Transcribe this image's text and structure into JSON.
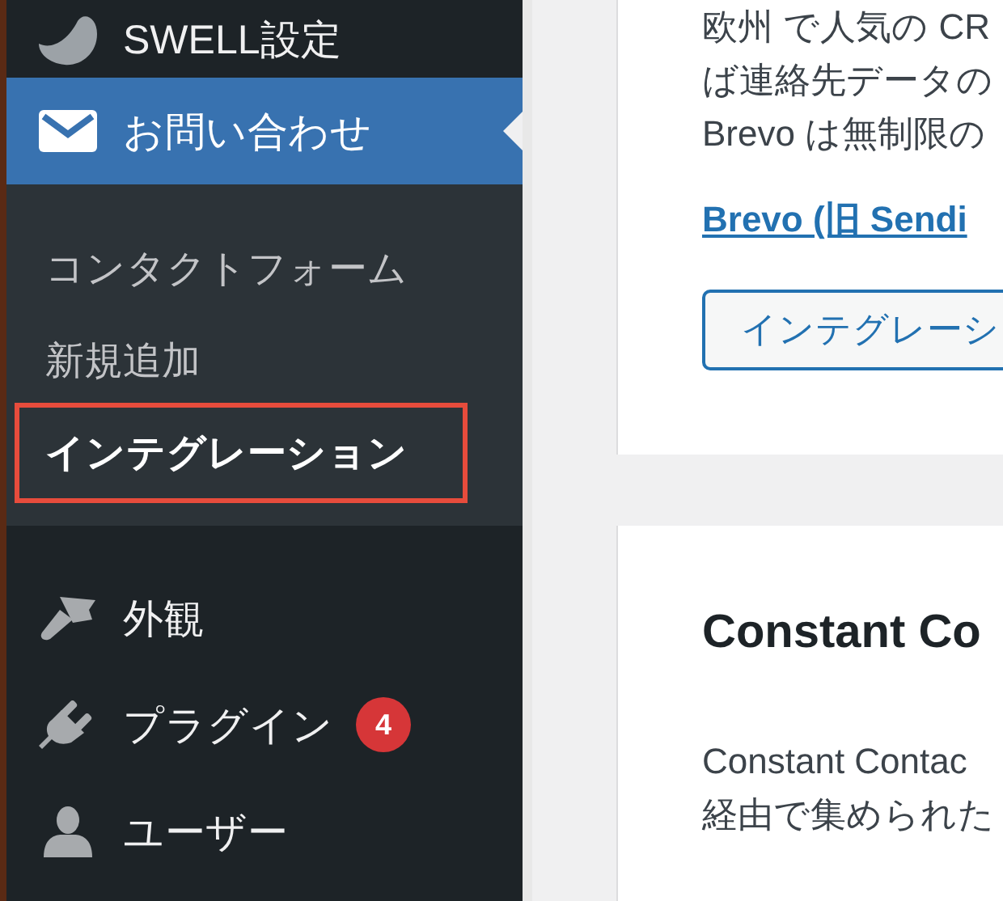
{
  "sidebar": {
    "items": [
      {
        "label": "SWELL設定",
        "selected": false
      },
      {
        "label": "お問い合わせ",
        "selected": true,
        "submenu": [
          {
            "label": "コンタクトフォーム",
            "selected": false,
            "highlighted": false
          },
          {
            "label": "新規追加",
            "selected": false,
            "highlighted": false
          },
          {
            "label": "インテグレーション",
            "selected": true,
            "highlighted": true
          }
        ]
      },
      {
        "label": "外観",
        "selected": false
      },
      {
        "label": "プラグイン",
        "selected": false,
        "badge": "4"
      },
      {
        "label": "ユーザー",
        "selected": false
      }
    ]
  },
  "cards": [
    {
      "lines": [
        "欧州 で人気の CR",
        "ば連絡先データの",
        "Brevo は無制限の"
      ],
      "link": "Brevo (旧 Sendi",
      "button": "インテグレーシ"
    },
    {
      "title": "Constant Co",
      "lines": [
        "Constant Contac",
        "経由で集められた"
      ]
    }
  ]
}
